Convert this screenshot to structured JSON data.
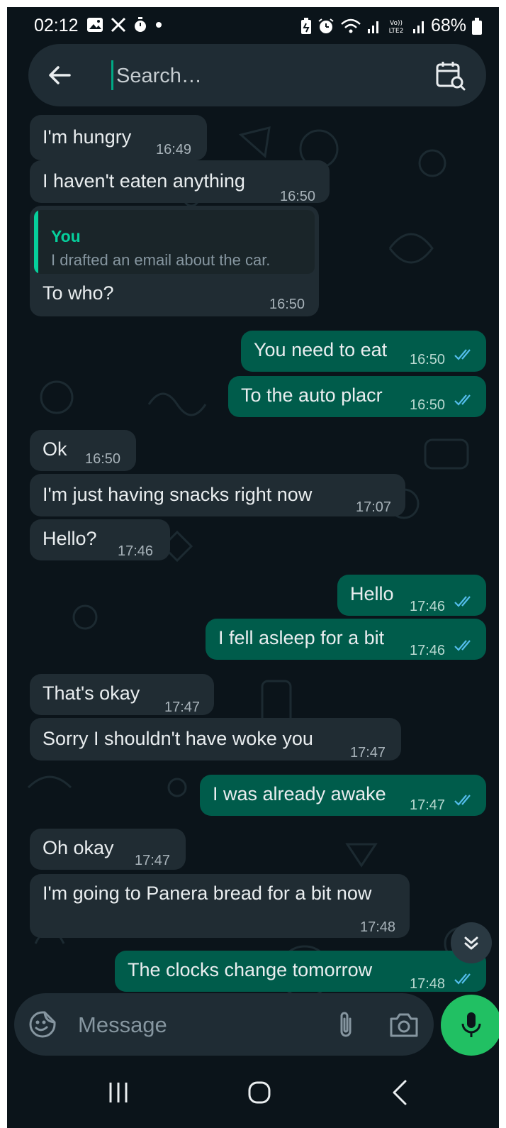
{
  "status_bar": {
    "time": "02:12",
    "battery": "68%",
    "left_icons": [
      "gallery-icon",
      "x-logo-icon",
      "timer-icon",
      "dot-icon"
    ],
    "right_icons": [
      "battery-saver-icon",
      "alarm-icon",
      "wifi-icon",
      "signal-icon",
      "volte-icon",
      "signal-icon",
      "battery-icon"
    ],
    "volte_label": "Vo)) LTE2"
  },
  "search": {
    "placeholder": "Search…"
  },
  "colors": {
    "background": "#0b141a",
    "incoming_bubble": "#202c33",
    "outgoing_bubble": "#005c4b",
    "accent": "#21c063",
    "read_ticks": "#53bdeb",
    "quote_accent": "#06cf9c"
  },
  "messages": [
    {
      "dir": "in",
      "text": "I'm hungry",
      "time": "16:49"
    },
    {
      "dir": "in",
      "text": "I haven't eaten anything",
      "time": "16:50"
    },
    {
      "dir": "in",
      "text": "To who?",
      "time": "16:50",
      "quote": {
        "author": "You",
        "text": "I drafted an email about the car."
      }
    },
    {
      "dir": "out",
      "text": "You need to eat",
      "time": "16:50",
      "status": "read"
    },
    {
      "dir": "out",
      "text": "To the auto placr",
      "time": "16:50",
      "status": "read"
    },
    {
      "dir": "in",
      "text": "Ok",
      "time": "16:50"
    },
    {
      "dir": "in",
      "text": "I'm just having snacks right now",
      "time": "17:07"
    },
    {
      "dir": "in",
      "text": "Hello?",
      "time": "17:46"
    },
    {
      "dir": "out",
      "text": "Hello",
      "time": "17:46",
      "status": "read"
    },
    {
      "dir": "out",
      "text": "I fell asleep for a bit",
      "time": "17:46",
      "status": "read"
    },
    {
      "dir": "in",
      "text": "That's okay",
      "time": "17:47"
    },
    {
      "dir": "in",
      "text": "Sorry I shouldn't have woke you",
      "time": "17:47"
    },
    {
      "dir": "out",
      "text": "I was already awake",
      "time": "17:47",
      "status": "read"
    },
    {
      "dir": "in",
      "text": "Oh okay",
      "time": "17:47"
    },
    {
      "dir": "in",
      "text": "I'm going to Panera bread for a bit now",
      "time": "17:48"
    },
    {
      "dir": "out",
      "text": "The clocks change tomorrow",
      "time": "17:48",
      "status": "read"
    }
  ],
  "composer": {
    "placeholder": "Message"
  },
  "icons": {
    "header": [
      "back-arrow-icon",
      "calendar-search-icon"
    ],
    "composer": [
      "sticker-icon",
      "paperclip-icon",
      "camera-icon",
      "microphone-icon"
    ],
    "scroll": "double-chevron-down-icon",
    "nav": [
      "recents-icon",
      "home-icon",
      "back-icon"
    ]
  }
}
